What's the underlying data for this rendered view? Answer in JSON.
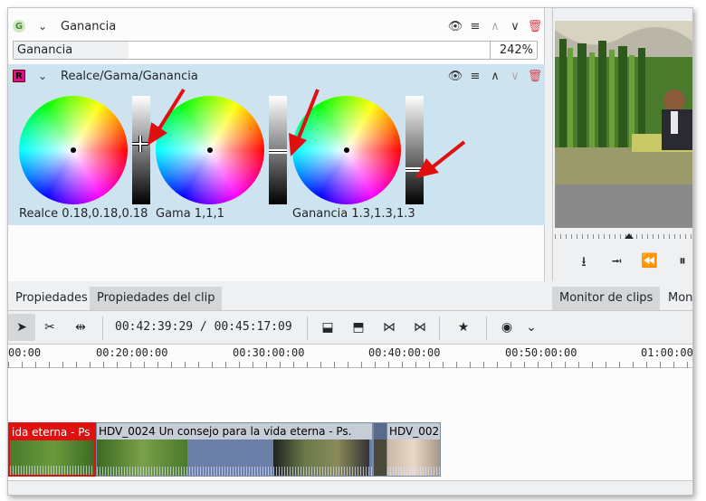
{
  "effects": {
    "gain": {
      "badge": "G",
      "title": "Ganancia",
      "slider_label": "Ganancia",
      "slider_value": "242%",
      "slider_fraction": 0.22
    },
    "lgg": {
      "badge": "R",
      "title": "Realce/Gama/Ganancia",
      "wheels": [
        {
          "label": "Realce 0.18,0.18,0.18"
        },
        {
          "label": "Gama 1,1,1"
        },
        {
          "label": "Ganancia 1.3,1.3,1.3"
        }
      ]
    }
  },
  "tabs": {
    "left": [
      "Propiedades",
      "Propiedades del clip"
    ],
    "right": [
      "Monitor de clips",
      "Mon"
    ]
  },
  "toolbar": {
    "timecode": "00:42:39:29 / 00:45:17:09"
  },
  "timeline": {
    "ticks": [
      "00:00",
      "00:20:00:00",
      "00:30:00:00",
      "00:40:00:00",
      "00:50:00:00",
      "01:00:00"
    ],
    "clips": [
      {
        "title": "ida eterna - Ps"
      },
      {
        "title": "HDV_0024 Un consejo para la vida eterna - Ps."
      },
      {
        "title": "HDV_002"
      }
    ]
  },
  "icons": {
    "eye": "eye-icon",
    "menu": "menu-icon",
    "up": "chevron-up-icon",
    "down": "chevron-down-icon",
    "delete": "trash-icon"
  },
  "colors": {
    "selection_bg": "#cde3f0",
    "selected_clip": "#e01010",
    "arrow": "#e01010"
  }
}
